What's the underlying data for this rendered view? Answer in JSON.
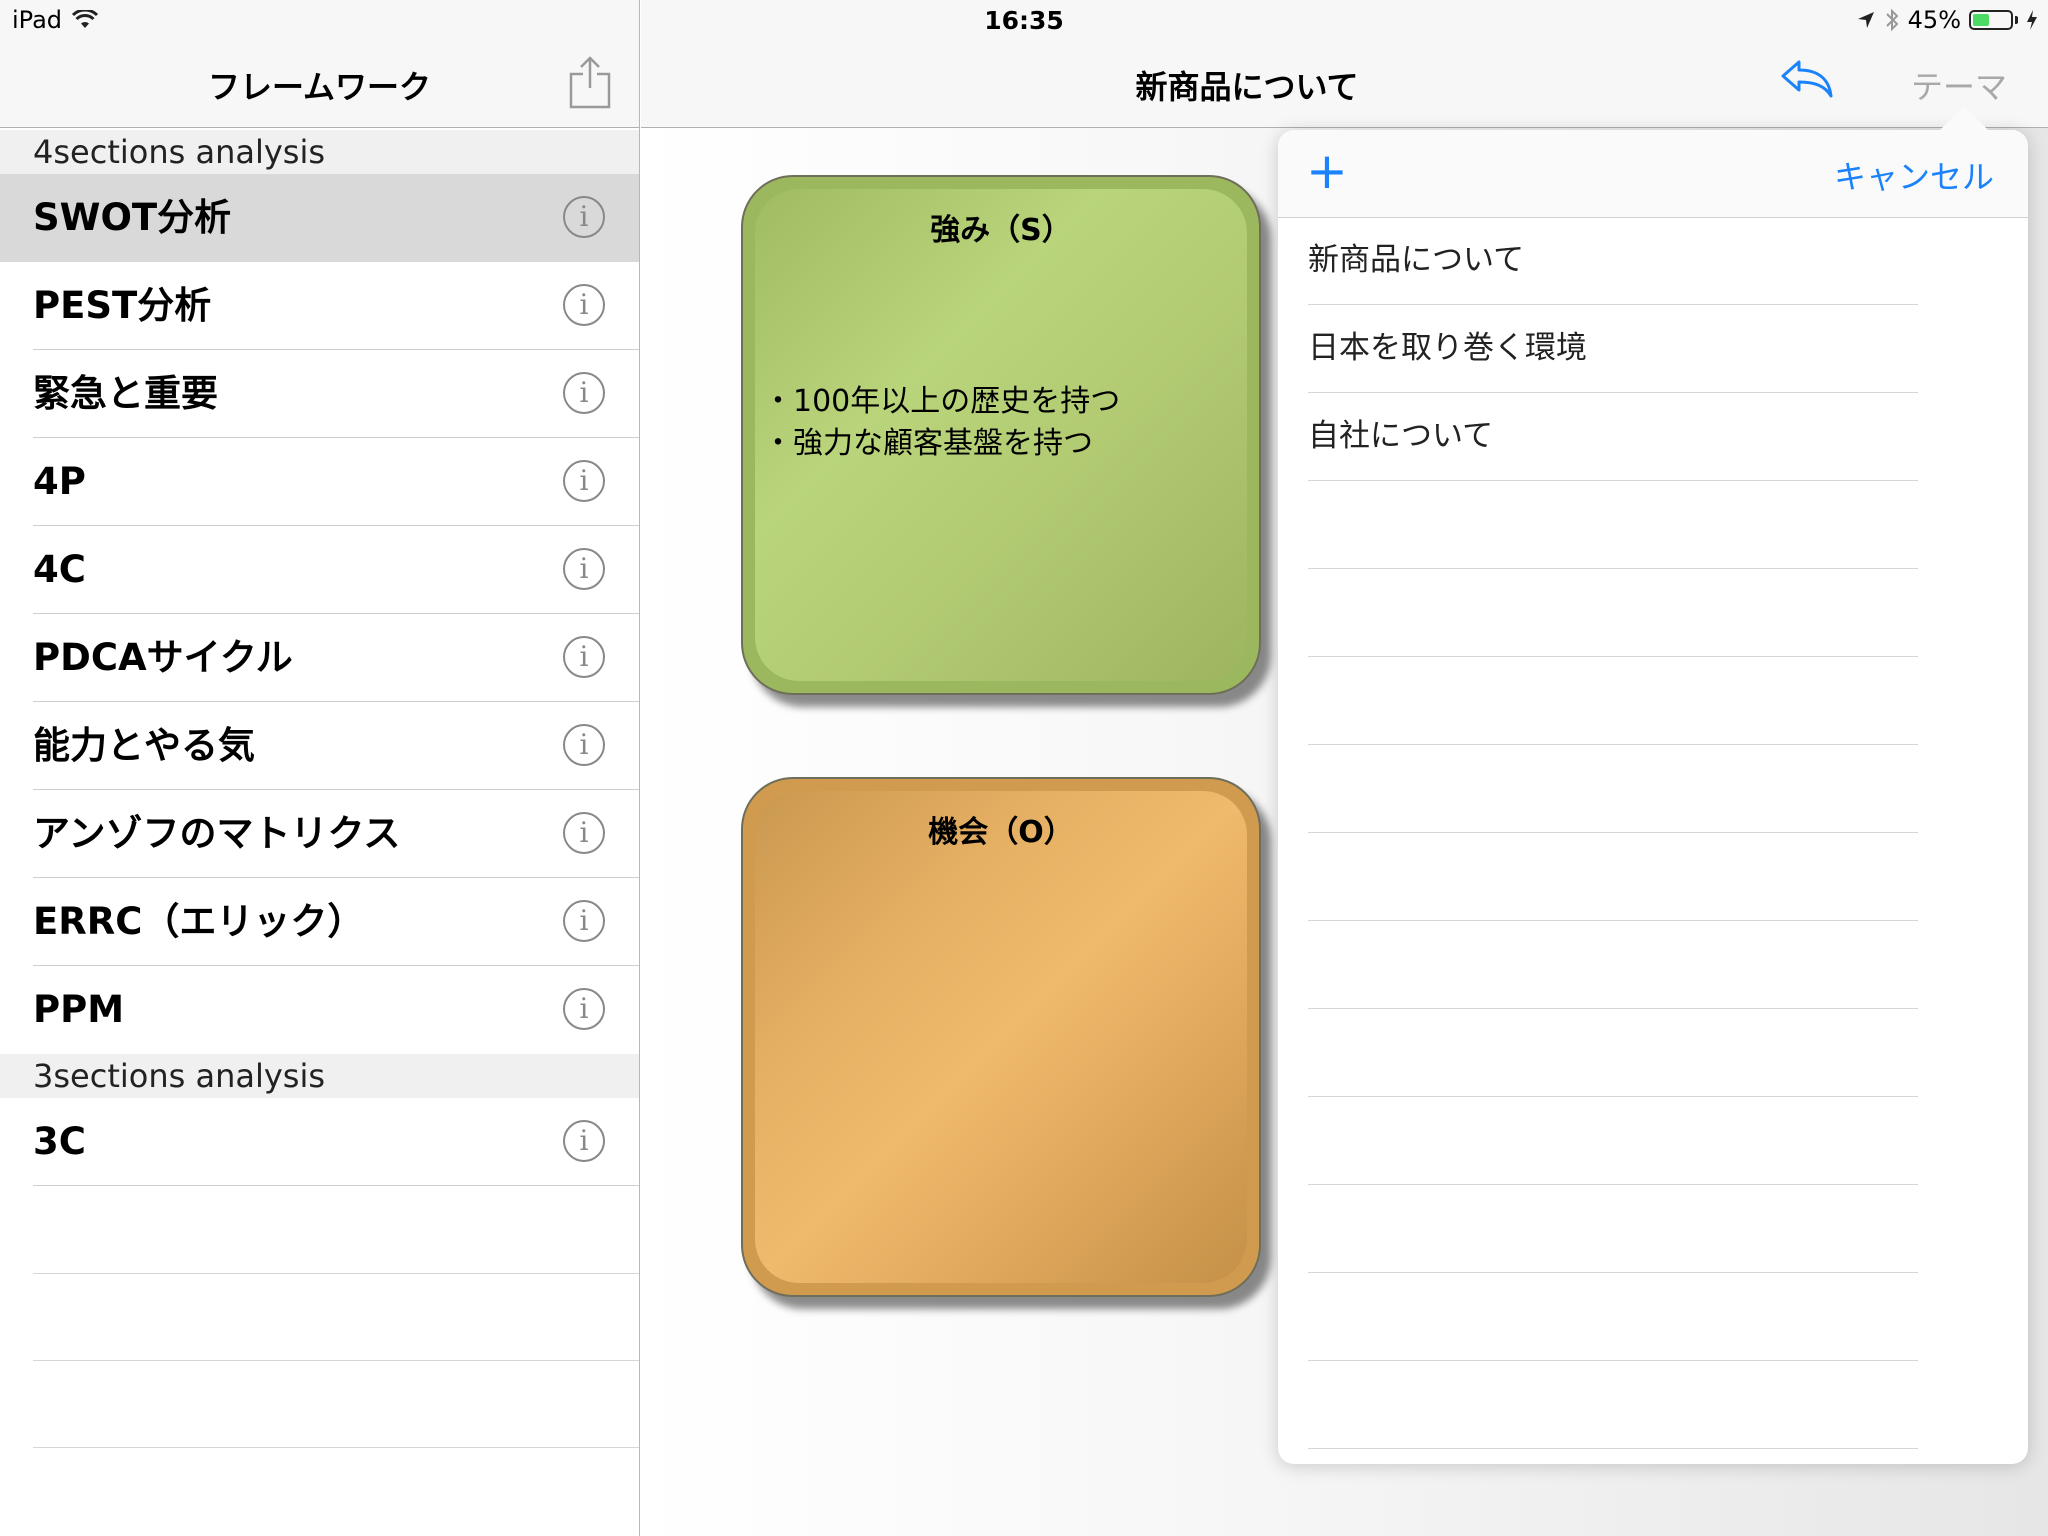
{
  "status_bar": {
    "device": "iPad",
    "time": "16:35",
    "battery_percent": "45%",
    "battery_level": 0.45
  },
  "master": {
    "title": "フレームワーク",
    "sections": [
      {
        "header": "4sections analysis",
        "items": [
          {
            "label": "SWOT分析",
            "selected": true
          },
          {
            "label": "PEST分析"
          },
          {
            "label": "緊急と重要"
          },
          {
            "label": "4P"
          },
          {
            "label": "4C"
          },
          {
            "label": "PDCAサイクル"
          },
          {
            "label": "能力とやる気"
          },
          {
            "label": "アンゾフのマトリクス"
          },
          {
            "label": "ERRC（エリック）"
          },
          {
            "label": "PPM"
          }
        ]
      },
      {
        "header": "3sections analysis",
        "items": [
          {
            "label": "3C"
          }
        ]
      }
    ],
    "info_glyph": "i"
  },
  "detail": {
    "title": "新商品について",
    "theme_label": "テーマ",
    "cards": [
      {
        "title": "強み（S）",
        "lines": [
          "・100年以上の歴史を持つ",
          "・強力な顧客基盤を持つ"
        ],
        "color": "#b2cb73"
      },
      {
        "title": "機会（O）",
        "lines": [],
        "color": "#e6b064"
      }
    ]
  },
  "popover": {
    "add_glyph": "+",
    "cancel_label": "キャンセル",
    "items": [
      "新商品について",
      "日本を取り巻く環境",
      "自社について"
    ]
  },
  "colors": {
    "accent": "#1a82fb",
    "selected_row": "#d9d9d9"
  }
}
